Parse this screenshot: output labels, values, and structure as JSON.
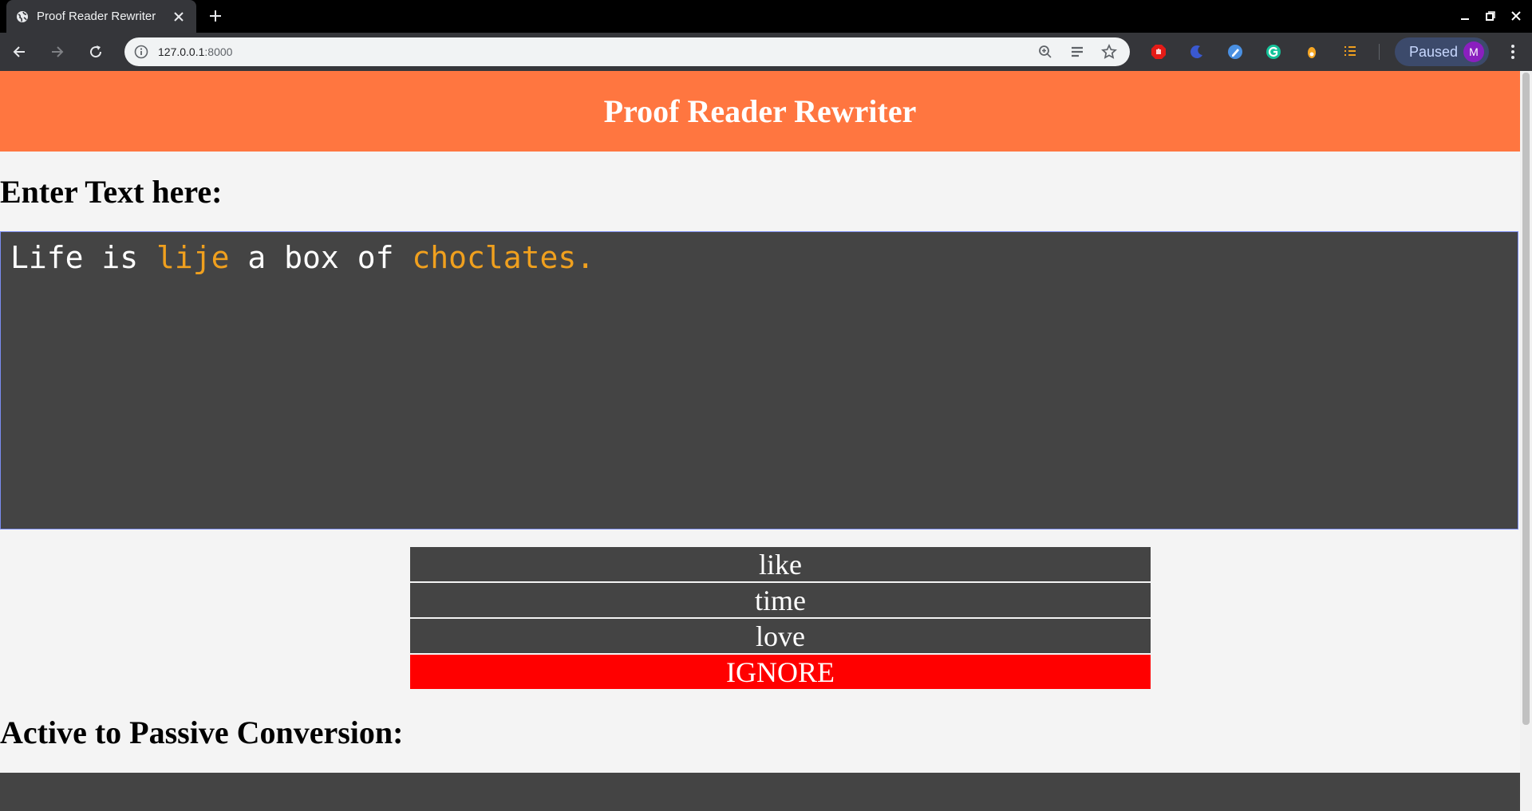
{
  "browser": {
    "tab_title": "Proof Reader Rewriter",
    "url_host": "127.0.0.1",
    "url_port": ":8000",
    "profile_label": "Paused",
    "avatar_letter": "M"
  },
  "page": {
    "title": "Proof Reader Rewriter",
    "input_heading": "Enter Text here:",
    "editor_text": [
      {
        "text": "Life is ",
        "error": false
      },
      {
        "text": "lije",
        "error": true
      },
      {
        "text": " a box of ",
        "error": false
      },
      {
        "text": "choclates.",
        "error": true
      }
    ],
    "suggestions": [
      "like",
      "time",
      "love"
    ],
    "ignore_label": "IGNORE",
    "conversion_heading": "Active to Passive Conversion:"
  },
  "colors": {
    "header_bg": "#ff7640",
    "editor_bg": "#444444",
    "error_text": "#f0a01e",
    "ignore_bg": "#ff0000"
  }
}
